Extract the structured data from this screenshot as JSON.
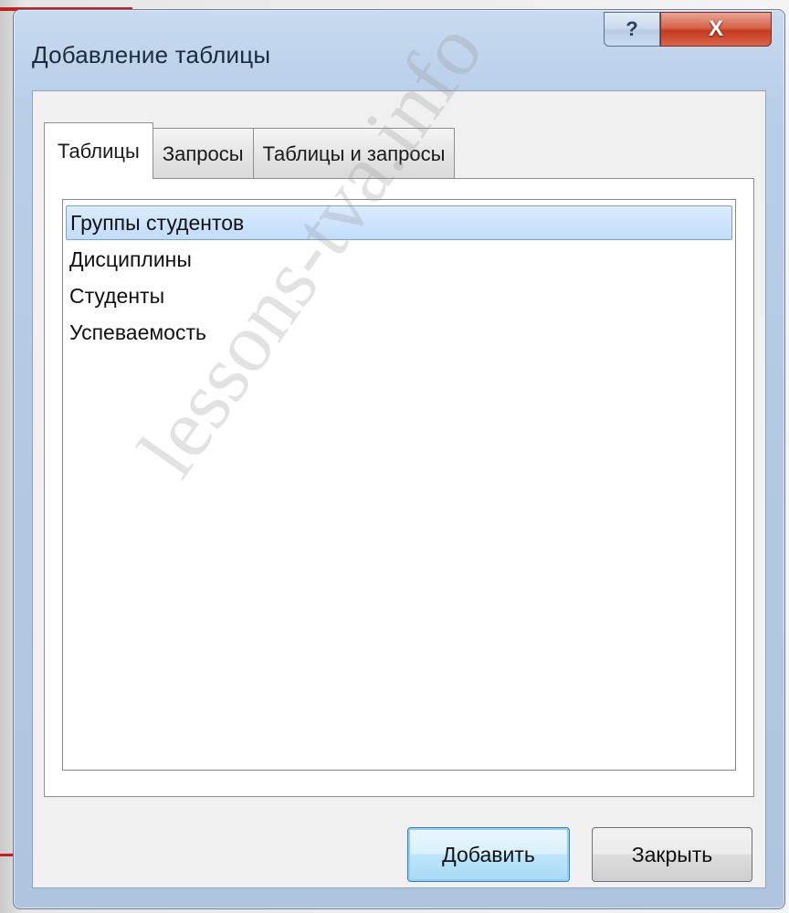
{
  "window": {
    "title": "Добавление таблицы",
    "help_label": "?",
    "close_label": "X"
  },
  "tabs": [
    {
      "label": "Таблицы",
      "active": true
    },
    {
      "label": "Запросы",
      "active": false
    },
    {
      "label": "Таблицы и запросы",
      "active": false
    }
  ],
  "list": {
    "items": [
      {
        "label": "Группы студентов",
        "selected": true
      },
      {
        "label": "Дисциплины",
        "selected": false
      },
      {
        "label": "Студенты",
        "selected": false
      },
      {
        "label": "Успеваемость",
        "selected": false
      }
    ]
  },
  "buttons": {
    "add_label": "Добавить",
    "close_label": "Закрыть"
  },
  "watermark": "lessons-tva.info",
  "colors": {
    "selection": "#c1dcfc",
    "close_button": "#c43a1f",
    "title_frame": "#b9cfe8"
  }
}
